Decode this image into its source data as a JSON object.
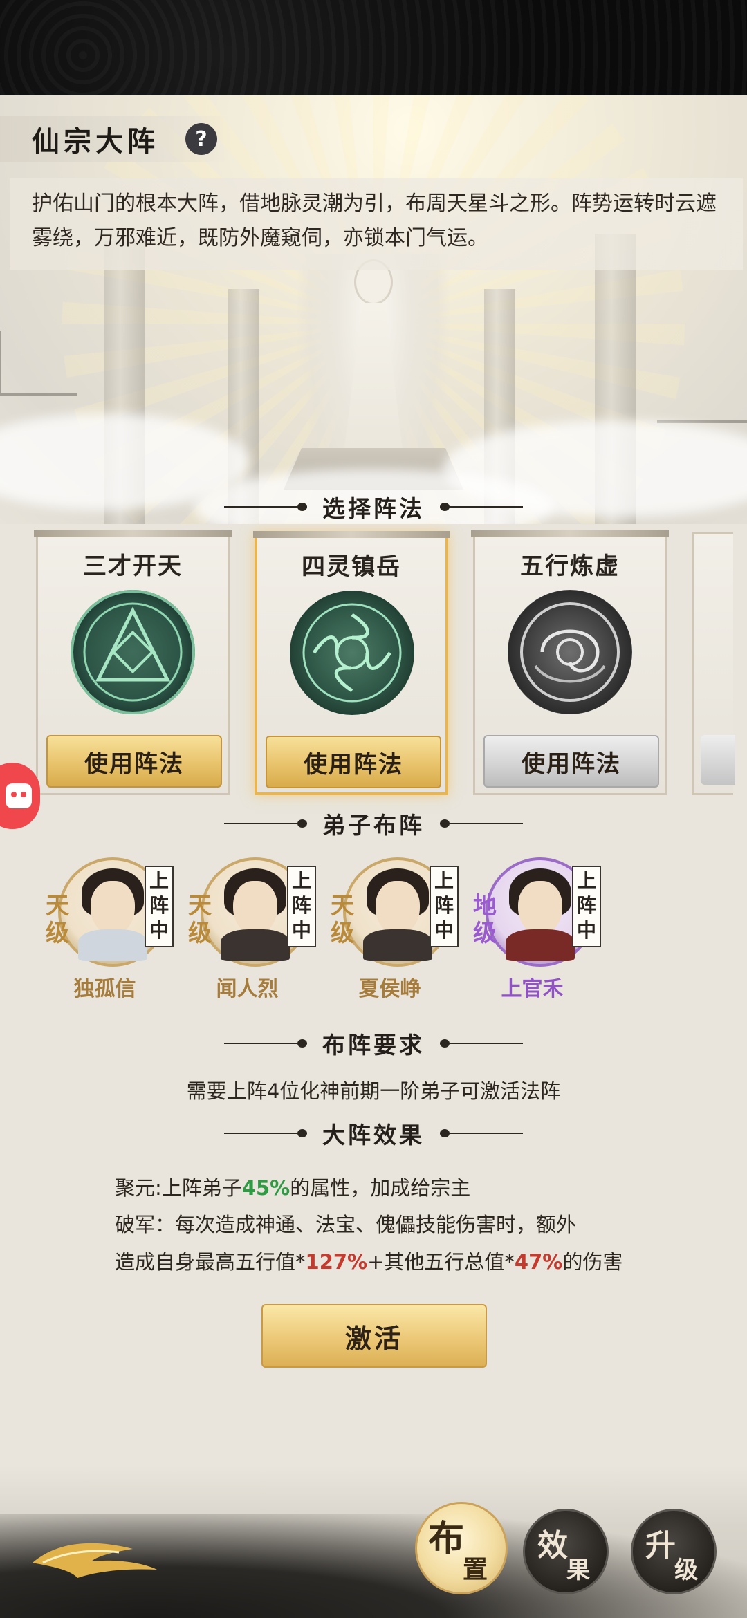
{
  "header": {
    "title": "仙宗大阵",
    "help_icon": "?",
    "description": "护佑山门的根本大阵，借地脉灵潮为引，布周天星斗之形。阵势运转时云遮雾绕，万邪难近，既防外魔窥伺，亦锁本门气运。"
  },
  "sections": {
    "select_formation": "选择阵法",
    "disciples": "弟子布阵",
    "requirement": "布阵要求",
    "effects": "大阵效果"
  },
  "formations": [
    {
      "name": "三才开天",
      "button": "使用阵法",
      "style": "gold",
      "selected": false
    },
    {
      "name": "四灵镇岳",
      "button": "使用阵法",
      "style": "gold",
      "selected": true
    },
    {
      "name": "五行炼虚",
      "button": "使用阵法",
      "style": "grey",
      "selected": false
    }
  ],
  "disciples": [
    {
      "name": "独孤信",
      "rank": "天级",
      "rank_chars": [
        "天",
        "级"
      ],
      "status": "上阵中",
      "status_chars": [
        "上",
        "阵",
        "中"
      ],
      "color": "gold"
    },
    {
      "name": "闻人烈",
      "rank": "天级",
      "rank_chars": [
        "天",
        "级"
      ],
      "status": "上阵中",
      "status_chars": [
        "上",
        "阵",
        "中"
      ],
      "color": "gold"
    },
    {
      "name": "夏侯峥",
      "rank": "天级",
      "rank_chars": [
        "天",
        "级"
      ],
      "status": "上阵中",
      "status_chars": [
        "上",
        "阵",
        "中"
      ],
      "color": "gold"
    },
    {
      "name": "上官禾",
      "rank": "地级",
      "rank_chars": [
        "地",
        "级"
      ],
      "status": "上阵中",
      "status_chars": [
        "上",
        "阵",
        "中"
      ],
      "color": "purple"
    }
  ],
  "requirement_text": "需要上阵4位化神前期一阶弟子可激活法阵",
  "effects": {
    "line1_prefix": "聚元:上阵弟子",
    "line1_value": "45%",
    "line1_suffix": "的属性，加成给宗主",
    "line2": "破军：每次造成神通、法宝、傀儡技能伤害时，额外",
    "line3_a": "造成自身最高五行值*",
    "line3_v1": "127%",
    "line3_b": "+其他五行总值*",
    "line3_v2": "47%",
    "line3_c": "的伤害"
  },
  "activate_button": "激活",
  "bottom_nav": [
    {
      "c1": "布",
      "c2": "置",
      "active": true
    },
    {
      "c1": "效",
      "c2": "果",
      "active": false
    },
    {
      "c1": "升",
      "c2": "级",
      "active": false
    }
  ],
  "colors": {
    "accent_gold": "#e8c36c",
    "highlight_green": "#2f9a44",
    "highlight_red": "#c53a2e",
    "rank_purple": "#9a5bd0"
  }
}
